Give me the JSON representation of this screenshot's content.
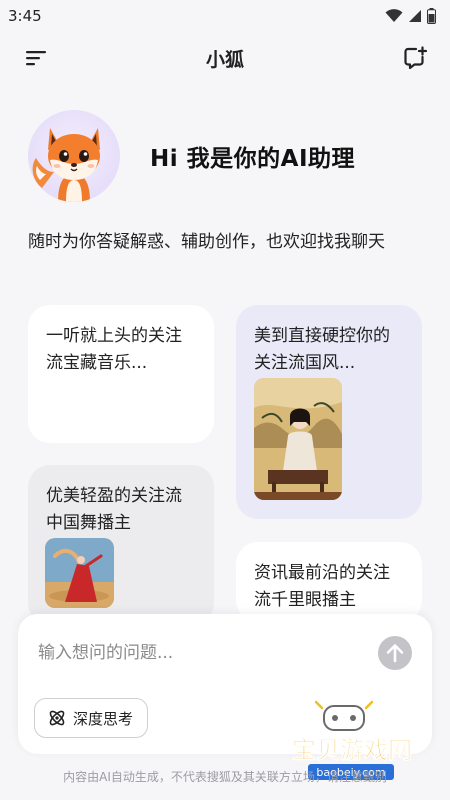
{
  "status_bar": {
    "time": "3:45"
  },
  "header": {
    "title": "小狐"
  },
  "hero": {
    "greeting": "Hi 我是你的AI助理"
  },
  "intro": "随时为你答疑解惑、辅助创作，也欢迎找我聊天",
  "cards": [
    {
      "text": "一听就上头的关注流宝藏音乐..."
    },
    {
      "text": "美到直接硬控你的关注流国风..."
    },
    {
      "text": "优美轻盈的关注流中国舞播主"
    },
    {
      "text": "资讯最前沿的关注流千里眼播主"
    }
  ],
  "composer": {
    "placeholder": "输入想问的问题...",
    "deep_think_label": "深度思考"
  },
  "disclaimer": "内容由AI自动生成，不代表搜狐及其关联方立场，请注意甄别",
  "watermark": {
    "brand": "宝贝游戏网",
    "domain": "baobeiy.com"
  },
  "icons": {
    "menu": "menu-icon",
    "new_chat": "new-chat-icon",
    "send": "arrow-up-icon",
    "deep_think": "atom-icon",
    "wifi": "wifi-icon",
    "signal": "signal-icon",
    "battery": "battery-icon"
  },
  "colors": {
    "background": "#f6f6f8",
    "card_highlight": "#e9e9f8",
    "send_button": "#c4c4c8"
  }
}
